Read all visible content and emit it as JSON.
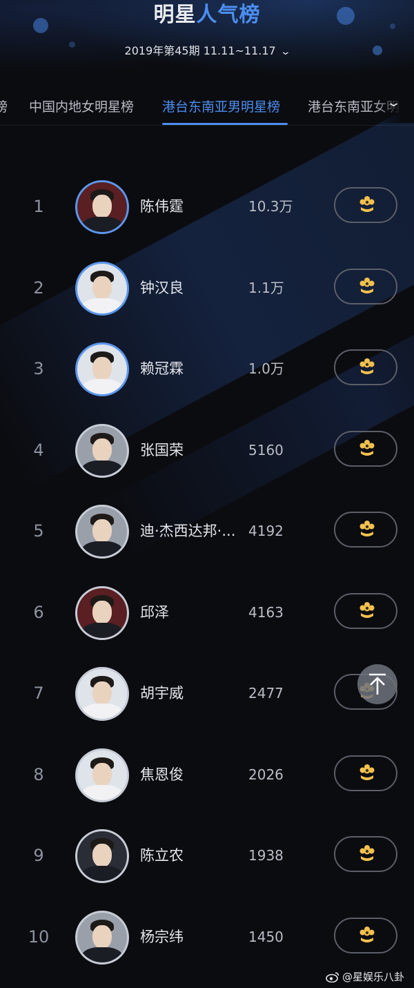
{
  "header": {
    "title_part1": "明星",
    "title_part2": "人气榜",
    "period": "2019年第45期 11.11~11.17"
  },
  "tabs": [
    {
      "label": "榜"
    },
    {
      "label": "中国内地女明星榜"
    },
    {
      "label": "港台东南亚男明星榜",
      "active": true
    },
    {
      "label": "港台东南亚女明"
    }
  ],
  "rows": [
    {
      "rank": "1",
      "name": "陈伟霆",
      "score": "10.3万"
    },
    {
      "rank": "2",
      "name": "钟汉良",
      "score": "1.1万"
    },
    {
      "rank": "3",
      "name": "赖冠霖",
      "score": "1.0万"
    },
    {
      "rank": "4",
      "name": "张国荣",
      "score": "5160"
    },
    {
      "rank": "5",
      "name": "迪·杰西达邦·...",
      "score": "4192"
    },
    {
      "rank": "6",
      "name": "邱泽",
      "score": "4163"
    },
    {
      "rank": "7",
      "name": "胡宇威",
      "score": "2477"
    },
    {
      "rank": "8",
      "name": "焦恩俊",
      "score": "2026"
    },
    {
      "rank": "9",
      "name": "陈立农",
      "score": "1938"
    },
    {
      "rank": "10",
      "name": "杨宗纬",
      "score": "1450"
    }
  ],
  "watermark": "@星娱乐八卦",
  "colors": {
    "accent": "#4c8ef0",
    "background": "#0b0c10",
    "support_icon": "#f2c14e"
  },
  "icons": {
    "period_dropdown": "chevron-down-icon",
    "tabs_more": "chevron-down-icon",
    "support": "flower-icon",
    "scroll_top": "arrow-up-icon"
  }
}
